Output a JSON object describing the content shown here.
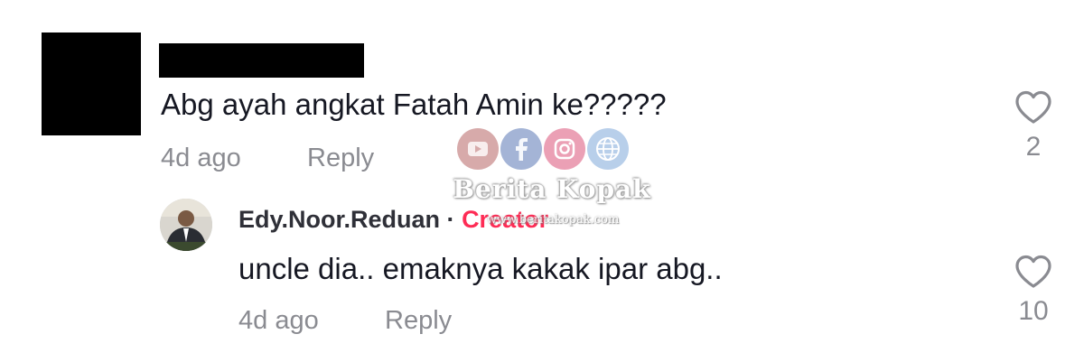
{
  "comment": {
    "text": "Abg ayah angkat Fatah Amin ke?????",
    "time": "4d ago",
    "reply_label": "Reply",
    "like_count": "2"
  },
  "reply": {
    "author": "Edy.Noor.Reduan",
    "separator": "·",
    "badge": "Creator",
    "text": "uncle dia.. emaknya kakak ipar abg..",
    "time": "4d ago",
    "reply_label": "Reply",
    "like_count": "10"
  },
  "watermark": {
    "title": "Berita Kopak",
    "url": "www.beritakopak.com"
  },
  "colors": {
    "creator_badge": "#fe2c55",
    "muted_text": "#8a8b91",
    "primary_text": "#161823"
  },
  "icons": [
    "heart-outline-icon",
    "avatar-photo",
    "youtube-icon",
    "facebook-icon",
    "instagram-icon",
    "globe-icon"
  ]
}
